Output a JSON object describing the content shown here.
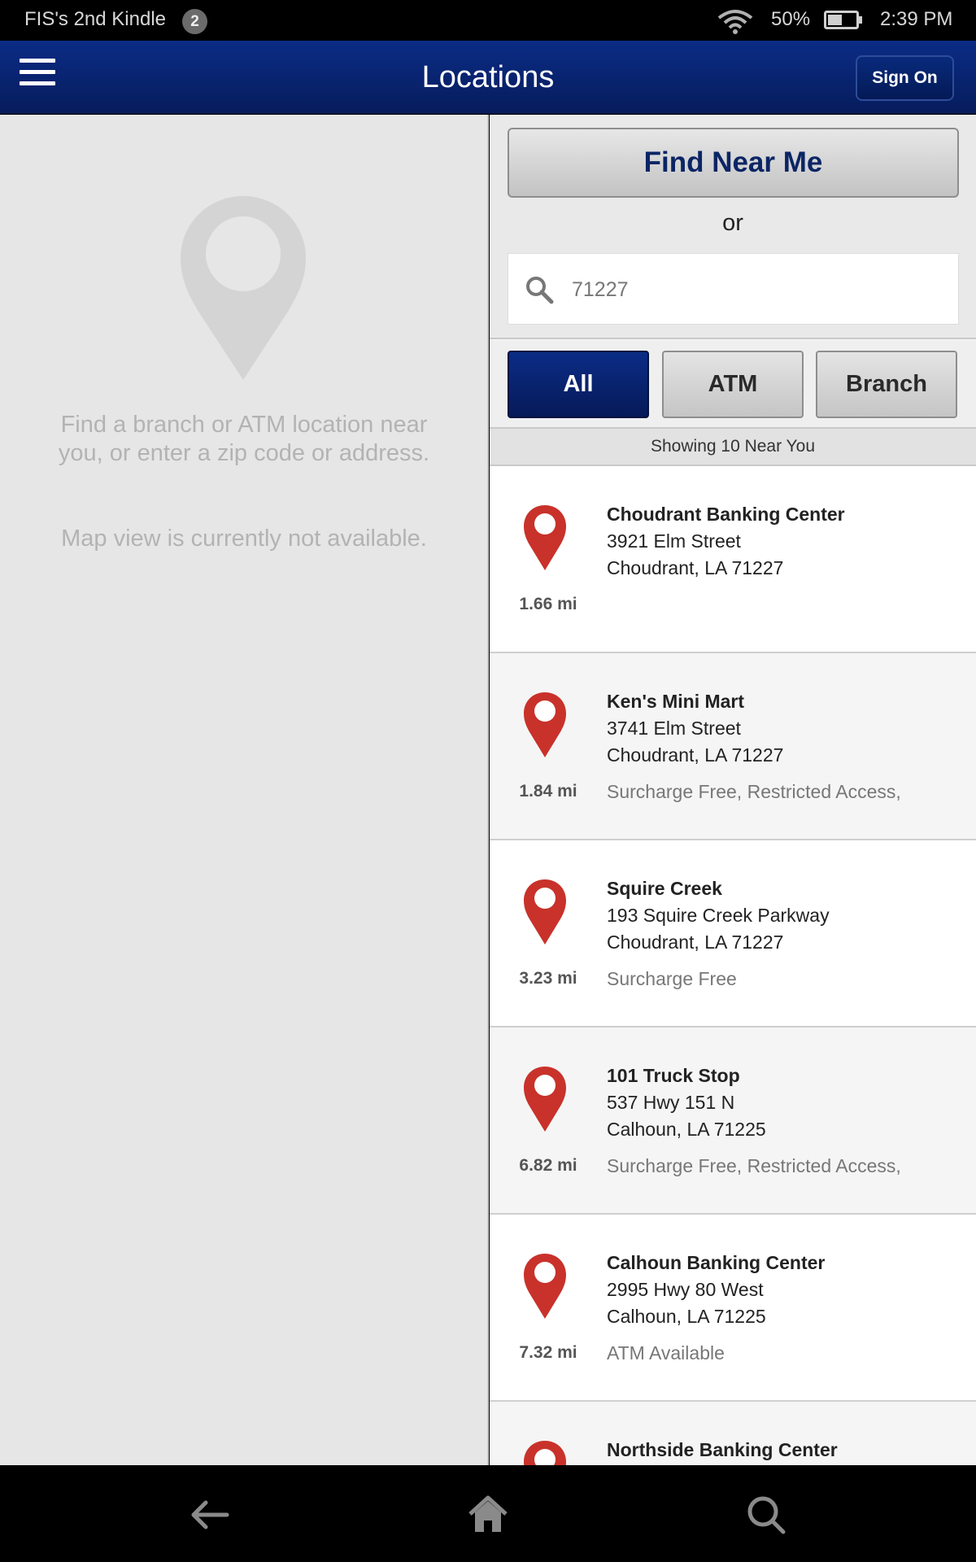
{
  "status_bar": {
    "device_name": "FIS's 2nd Kindle",
    "notification_count": "2",
    "battery_percent": "50%",
    "time": "2:39 PM"
  },
  "header": {
    "title": "Locations",
    "sign_on_label": "Sign On"
  },
  "map_panel": {
    "message_1": "Find a branch or ATM location near you, or enter a zip code or address.",
    "message_2": "Map view is currently not available."
  },
  "search": {
    "find_near_me_label": "Find Near Me",
    "or_text": "or",
    "query_value": "71227"
  },
  "filters": {
    "all_label": "All",
    "atm_label": "ATM",
    "branch_label": "Branch",
    "active": "All"
  },
  "results": {
    "showing_text": "Showing 10 Near You",
    "items": [
      {
        "name": "Choudrant Banking Center",
        "address1": "3921 Elm Street",
        "address2": "Choudrant, LA 71227",
        "distance": "1.66 mi",
        "features": ""
      },
      {
        "name": "Ken's Mini Mart",
        "address1": "3741 Elm Street",
        "address2": "Choudrant, LA 71227",
        "distance": "1.84 mi",
        "features": "Surcharge Free, Restricted Access,"
      },
      {
        "name": "Squire Creek",
        "address1": "193 Squire Creek Parkway",
        "address2": "Choudrant, LA 71227",
        "distance": "3.23 mi",
        "features": "Surcharge Free"
      },
      {
        "name": "101 Truck Stop",
        "address1": "537 Hwy 151 N",
        "address2": "Calhoun, LA 71225",
        "distance": "6.82 mi",
        "features": "Surcharge Free, Restricted Access,"
      },
      {
        "name": "Calhoun Banking Center",
        "address1": "2995 Hwy 80 West",
        "address2": "Calhoun, LA 71225",
        "distance": "7.32 mi",
        "features": "ATM Available"
      },
      {
        "name": "Northside Banking Center",
        "address1": "",
        "address2": "",
        "distance": "",
        "features": ""
      }
    ]
  },
  "colors": {
    "header_blue": "#0b2c86",
    "pin_red": "#c8322a",
    "active_filter": "#061a58"
  },
  "icons": {
    "menu": "hamburger-menu-icon",
    "search": "magnifier-icon",
    "location": "map-pin-icon",
    "back": "back-arrow-icon",
    "home": "home-icon"
  }
}
